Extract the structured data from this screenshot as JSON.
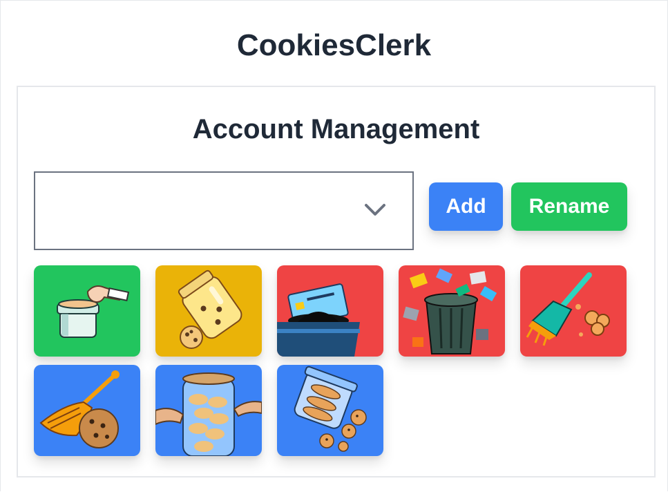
{
  "app": {
    "title": "CookiesClerk"
  },
  "panel": {
    "title": "Account Management",
    "account_select": {
      "value": ""
    },
    "add_label": "Add",
    "rename_label": "Rename"
  },
  "colors": {
    "green": "#22c55e",
    "yellow": "#eab308",
    "red": "#ef4444",
    "blue": "#3b82f6"
  },
  "actions": [
    {
      "name": "add-cookie-jar-action-icon",
      "color": "#22c55e"
    },
    {
      "name": "open-cookie-jar-action-icon",
      "color": "#eab308"
    },
    {
      "name": "insert-card-action-icon",
      "color": "#ef4444"
    },
    {
      "name": "trash-cards-action-icon",
      "color": "#ef4444"
    },
    {
      "name": "sweep-cookies-action-icon",
      "color": "#ef4444"
    },
    {
      "name": "sweep-cookie-action-icon",
      "color": "#3b82f6"
    },
    {
      "name": "cookie-jar-hands-action-icon",
      "color": "#3b82f6"
    },
    {
      "name": "spill-cookie-jar-action-icon",
      "color": "#3b82f6"
    }
  ]
}
